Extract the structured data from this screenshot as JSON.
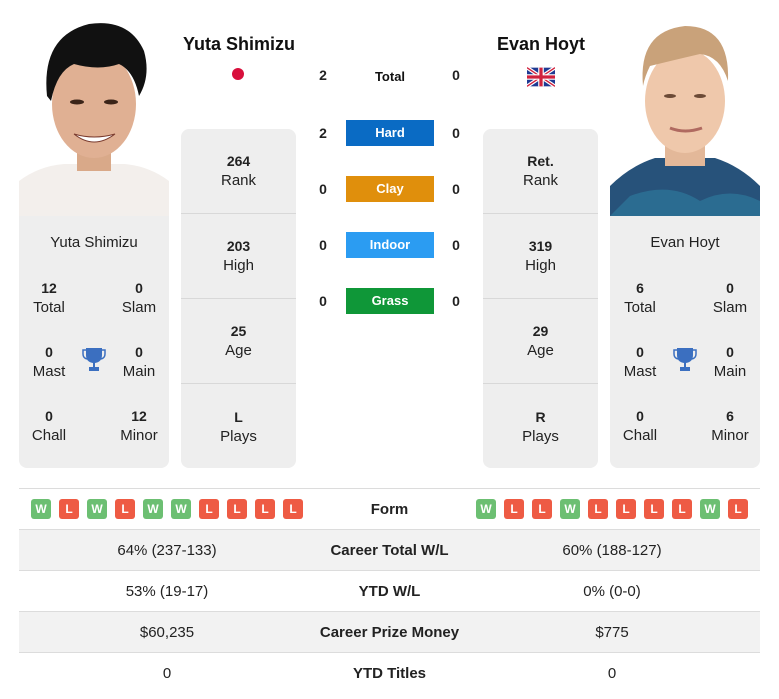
{
  "players": {
    "left": {
      "name": "Yuta Shimizu",
      "country_flag": "japan-flag",
      "titles": {
        "total": {
          "value": "12",
          "label": "Total"
        },
        "slam": {
          "value": "0",
          "label": "Slam"
        },
        "mast": {
          "value": "0",
          "label": "Mast"
        },
        "main": {
          "value": "0",
          "label": "Main"
        },
        "chall": {
          "value": "0",
          "label": "Chall"
        },
        "minor": {
          "value": "12",
          "label": "Minor"
        }
      },
      "stats": [
        {
          "value": "264",
          "label": "Rank"
        },
        {
          "value": "203",
          "label": "High"
        },
        {
          "value": "25",
          "label": "Age"
        },
        {
          "value": "L",
          "label": "Plays"
        }
      ],
      "form": [
        "W",
        "L",
        "W",
        "L",
        "W",
        "W",
        "L",
        "L",
        "L",
        "L"
      ]
    },
    "right": {
      "name": "Evan Hoyt",
      "country_flag": "uk-flag",
      "titles": {
        "total": {
          "value": "6",
          "label": "Total"
        },
        "slam": {
          "value": "0",
          "label": "Slam"
        },
        "mast": {
          "value": "0",
          "label": "Mast"
        },
        "main": {
          "value": "0",
          "label": "Main"
        },
        "chall": {
          "value": "0",
          "label": "Chall"
        },
        "minor": {
          "value": "6",
          "label": "Minor"
        }
      },
      "stats": [
        {
          "value": "Ret.",
          "label": "Rank"
        },
        {
          "value": "319",
          "label": "High"
        },
        {
          "value": "29",
          "label": "Age"
        },
        {
          "value": "R",
          "label": "Plays"
        }
      ],
      "form": [
        "W",
        "L",
        "L",
        "W",
        "L",
        "L",
        "L",
        "L",
        "W",
        "L"
      ]
    }
  },
  "h2h": [
    {
      "label": "Total",
      "left": "2",
      "right": "0",
      "color": null
    },
    {
      "label": "Hard",
      "left": "2",
      "right": "0",
      "color": "#0a6bc4"
    },
    {
      "label": "Clay",
      "left": "0",
      "right": "0",
      "color": "#e08f0c"
    },
    {
      "label": "Indoor",
      "left": "0",
      "right": "0",
      "color": "#2b9cf2"
    },
    {
      "label": "Grass",
      "left": "0",
      "right": "0",
      "color": "#0f9738"
    }
  ],
  "table": {
    "form_label": "Form",
    "rows": [
      {
        "label": "Career Total W/L",
        "left": "64% (237-133)",
        "right": "60% (188-127)"
      },
      {
        "label": "YTD W/L",
        "left": "53% (19-17)",
        "right": "0% (0-0)"
      },
      {
        "label": "Career Prize Money",
        "left": "$60,235",
        "right": "$775"
      },
      {
        "label": "YTD Titles",
        "left": "0",
        "right": "0"
      }
    ]
  },
  "colors": {
    "win": "#6cbf72",
    "loss": "#ee5b44",
    "trophy": "#3b6fc0"
  }
}
